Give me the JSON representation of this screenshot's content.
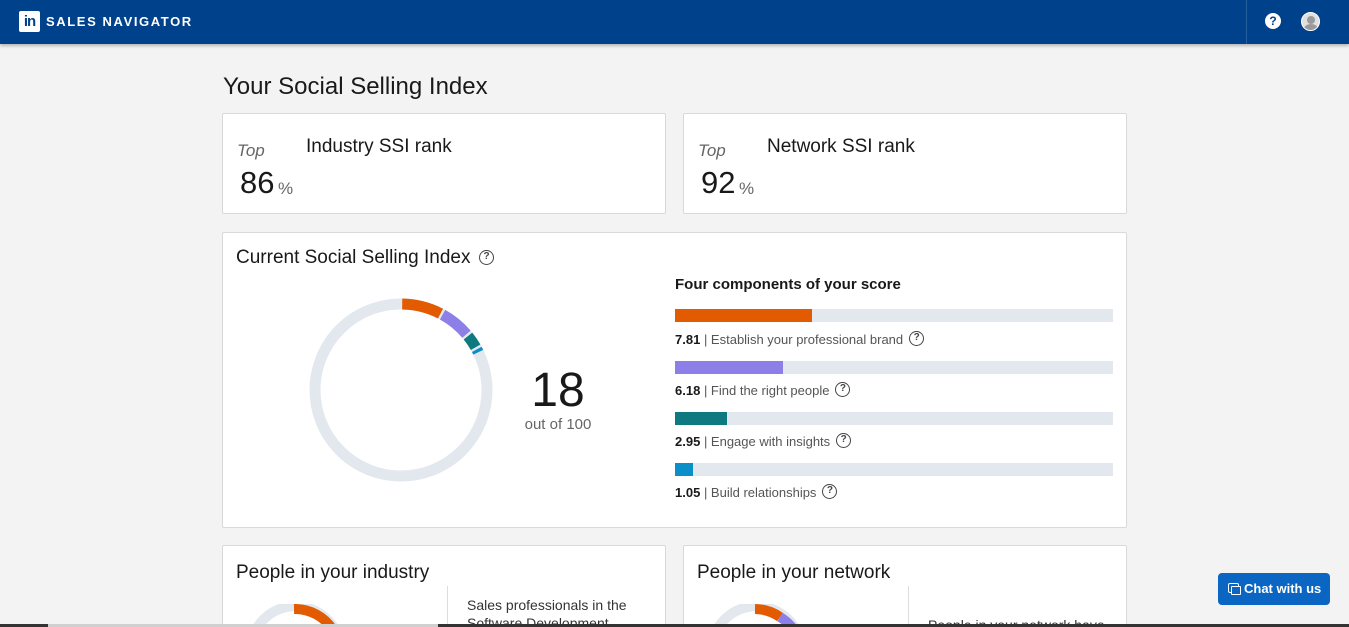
{
  "header": {
    "logo_text": "in",
    "brand": "SALES NAVIGATOR",
    "help_icon": "question-icon",
    "avatar_icon": "user-avatar-icon",
    "bg_color": "#00418b"
  },
  "page_title": "Your Social Selling Index",
  "industry_rank": {
    "prefix": "Top",
    "value": "86",
    "unit": "%",
    "label": "Industry SSI rank"
  },
  "network_rank": {
    "prefix": "Top",
    "value": "92",
    "unit": "%",
    "label": "Network SSI rank"
  },
  "current_ssi": {
    "title": "Current Social Selling Index",
    "score": "18",
    "score_sub": "out of 100",
    "total": 100,
    "components_title": "Four components of your score",
    "components": [
      {
        "value": "7.81",
        "label": "| Establish your professional brand",
        "max": 25,
        "color": "#e35b00"
      },
      {
        "value": "6.18",
        "label": "| Find the right people",
        "max": 25,
        "color": "#8c80e8"
      },
      {
        "value": "2.95",
        "label": "| Engage with insights",
        "max": 25,
        "color": "#0e7a7f"
      },
      {
        "value": "1.05",
        "label": "| Build relationships",
        "max": 25,
        "color": "#0a8fc8"
      }
    ]
  },
  "people_industry": {
    "title": "People in your industry",
    "text": "Sales professionals in the Software Development"
  },
  "people_network": {
    "title": "People in your network",
    "text": "People in your network have"
  },
  "chat": {
    "label": "Chat with us",
    "icon": "chat-icon"
  }
}
